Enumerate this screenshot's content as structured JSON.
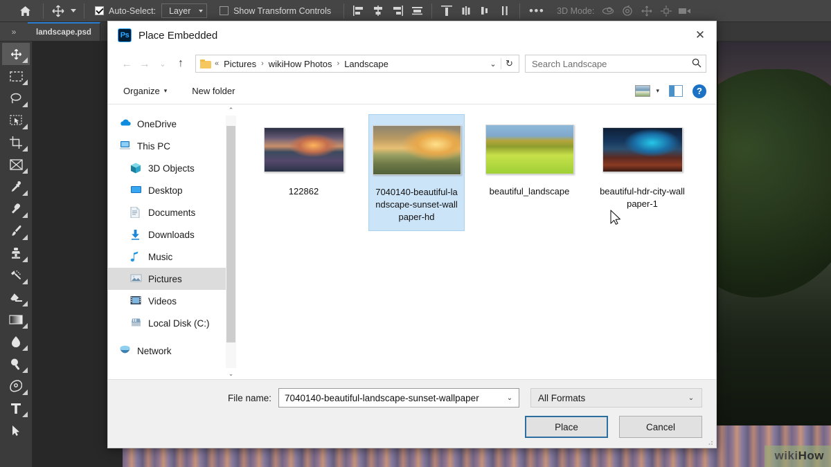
{
  "photoshop": {
    "options_bar": {
      "home_icon": "home-icon",
      "move_tool_icon": "move-tool-icon",
      "auto_select_label": "Auto-Select:",
      "auto_select_checked": true,
      "layer_select_value": "Layer",
      "show_transform_label": "Show Transform Controls",
      "show_transform_checked": false,
      "align_icons": [
        "align-left-edges-icon",
        "align-horizontal-centers-icon",
        "align-right-edges-icon",
        "align-top-edges-icon"
      ],
      "distribute_icons": [
        "distribute-top-edges-icon",
        "distribute-vertical-centers-icon",
        "distribute-bottom-edges-icon",
        "distribute-left-edges-icon"
      ],
      "more_label": "•••",
      "three_d_mode_label": "3D Mode:",
      "three_d_icons": [
        "orbit-3d-icon",
        "roll-3d-icon",
        "pan-3d-icon",
        "slide-3d-icon",
        "camera-3d-icon"
      ]
    },
    "tab_bar": {
      "expand_label": "»",
      "document_tab": "landscape.psd"
    },
    "tools": [
      {
        "name": "move-tool-icon",
        "active": true
      },
      {
        "name": "rectangular-marquee-tool-icon",
        "active": false
      },
      {
        "name": "lasso-tool-icon",
        "active": false
      },
      {
        "name": "object-selection-tool-icon",
        "active": false
      },
      {
        "name": "crop-tool-icon",
        "active": false
      },
      {
        "name": "frame-tool-icon",
        "active": false
      },
      {
        "name": "eyedropper-tool-icon",
        "active": false
      },
      {
        "name": "spot-healing-brush-tool-icon",
        "active": false
      },
      {
        "name": "brush-tool-icon",
        "active": false
      },
      {
        "name": "clone-stamp-tool-icon",
        "active": false
      },
      {
        "name": "history-brush-tool-icon",
        "active": false
      },
      {
        "name": "eraser-tool-icon",
        "active": false
      },
      {
        "name": "gradient-tool-icon",
        "active": false
      },
      {
        "name": "blur-tool-icon",
        "active": false
      },
      {
        "name": "dodge-tool-icon",
        "active": false
      },
      {
        "name": "pen-tool-icon",
        "active": false
      },
      {
        "name": "type-tool-icon",
        "active": false
      },
      {
        "name": "path-selection-tool-icon",
        "active": false
      }
    ],
    "canvas": {
      "watermark_a": "wiki",
      "watermark_b": "How"
    }
  },
  "dialog": {
    "app_icon": "photoshop-icon",
    "app_icon_text": "Ps",
    "title": "Place Embedded",
    "close_label": "✕",
    "nav": {
      "back_label": "←",
      "forward_label": "→",
      "recent_label": "⌄",
      "up_label": "↑",
      "folder_icon": "folder-icon",
      "breadcrumb_prefix": "«",
      "breadcrumbs": [
        "Pictures",
        "wikiHow Photos",
        "Landscape"
      ],
      "breadcrumb_separator": "›",
      "dropdown_label": "⌄",
      "refresh_label": "↻"
    },
    "search": {
      "placeholder": "Search Landscape",
      "icon": "search-icon"
    },
    "toolbar": {
      "organize_label": "Organize",
      "organize_caret": "▾",
      "new_folder_label": "New folder",
      "view_icon": "view-options-icon",
      "view_caret": "▾",
      "preview_pane_icon": "preview-pane-icon",
      "help_icon": "help-icon",
      "help_label": "?"
    },
    "sidebar": {
      "items": [
        {
          "label": "OneDrive",
          "icon": "onedrive-icon",
          "indent": false,
          "selected": false
        },
        {
          "label": "This PC",
          "icon": "this-pc-icon",
          "indent": false,
          "selected": false
        },
        {
          "label": "3D Objects",
          "icon": "3d-objects-icon",
          "indent": true,
          "selected": false
        },
        {
          "label": "Desktop",
          "icon": "desktop-icon",
          "indent": true,
          "selected": false
        },
        {
          "label": "Documents",
          "icon": "documents-icon",
          "indent": true,
          "selected": false
        },
        {
          "label": "Downloads",
          "icon": "downloads-icon",
          "indent": true,
          "selected": false
        },
        {
          "label": "Music",
          "icon": "music-icon",
          "indent": true,
          "selected": false
        },
        {
          "label": "Pictures",
          "icon": "pictures-icon",
          "indent": true,
          "selected": true
        },
        {
          "label": "Videos",
          "icon": "videos-icon",
          "indent": true,
          "selected": false
        },
        {
          "label": "Local Disk (C:)",
          "icon": "local-disk-icon",
          "indent": true,
          "selected": false
        },
        {
          "label": "Network",
          "icon": "network-icon",
          "indent": false,
          "selected": false
        }
      ],
      "scroll_up_label": "⌃",
      "scroll_down_label": "⌄"
    },
    "files": [
      {
        "name": "122862",
        "thumb": "th1",
        "selected": false
      },
      {
        "name": "7040140-beautiful-landscape-sunset-wallpaper-hd",
        "thumb": "th2",
        "selected": true
      },
      {
        "name": "beautiful_landscape",
        "thumb": "th3",
        "selected": false
      },
      {
        "name": "beautiful-hdr-city-wallpaper-1",
        "thumb": "th4",
        "selected": false
      }
    ],
    "footer": {
      "file_name_label": "File name:",
      "file_name_value": "7040140-beautiful-landscape-sunset-wallpaper",
      "file_name_caret": "⌄",
      "format_value": "All Formats",
      "format_caret": "⌄",
      "place_button": "Place",
      "cancel_button": "Cancel"
    }
  }
}
